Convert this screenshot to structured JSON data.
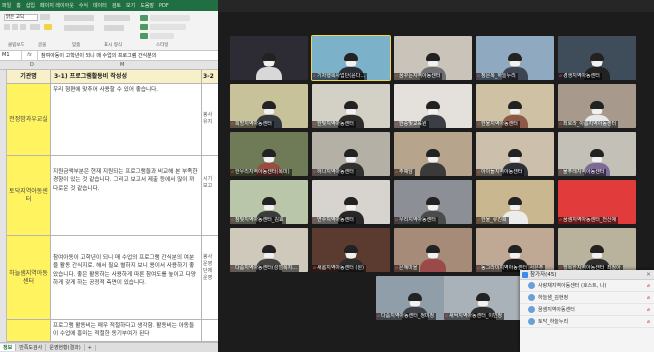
{
  "excel": {
    "ribbon_tabs": [
      "파일",
      "홈",
      "삽입",
      "페이지 레이아웃",
      "수식",
      "데이터",
      "검토",
      "보기",
      "도움말",
      "PDF"
    ],
    "font_box": "맑은 고딕",
    "ribbon_labels": [
      "클립보드",
      "글꼴",
      "맞춤",
      "표시 형식",
      "스타일"
    ],
    "formula_bar": {
      "cell_ref": "M1",
      "fx": "fx",
      "text": "참여아동이 고학년이 되니 매 수업의 프로그램 간식분의"
    },
    "columns": [
      "D",
      "M"
    ],
    "header_row": {
      "category": "기관명",
      "text": "3-1) 프로그램활동비 작성성",
      "side": "3-2"
    },
    "rows": [
      {
        "category": "전정밤과우교실",
        "text": "우리 형편에 맞추어 사용할 수 있어 좋습니다.",
        "side": "봉사 유지"
      },
      {
        "category": "토닥지역아동센터",
        "text": "지원금액부분은 현재 지원되는 프로그램들과 비교해 본 부족한 경향이 있는 것 같습니다. 그리고 보고서 제출 등에서 많이 까다로운 것 같습니다.",
        "side": "시기 보고"
      },
      {
        "category": "하늘샘지역아동센터",
        "text": "참여아동이 고학년이 되니 매 수업의 프로그램 간식분의 여분을 활동 간식지로. 해서 필요 별하지 보니 용이서 사용하기 좋았습니다. 좋은 활동하는 사용하게 따른 참여도를 높이고 다양하게 갖게 하는 공정적 측면이 있습니다.",
        "side": "봉사 운영 단체 운영"
      },
      {
        "category": "",
        "text": "프로그램 활동비는 매우 적절하다고 생각함. 활동비는 아동들이 수업에 흥미는 적절한 동기부여가 된다",
        "side": ""
      }
    ],
    "sheet_tabs": [
      "정보",
      "만족도검사",
      "운영현황(결과)",
      "+"
    ]
  },
  "zoom": {
    "participants": [
      {
        "name": "",
        "bg": "#2d2b33",
        "shirt": "#d8d8d8"
      },
      {
        "name": "기차행복사업단(윤다...",
        "bg": "#7bb2c9",
        "shirt": "#2a2d36",
        "active": true
      },
      {
        "name": "꿈꾸는지역아동센터",
        "bg": "#c9c3b9",
        "shirt": "#6d6f73"
      },
      {
        "name": "정은복_하늘누리",
        "bg": "#8fa9c0",
        "shirt": "#3e4552"
      },
      {
        "name": "경생지역아동센터",
        "bg": "#3f4c5a",
        "shirt": "#222"
      },
      {
        "name": "희망지역아동센터",
        "bg": "#c8c29a",
        "shirt": "#33373f"
      },
      {
        "name": "한빛지역아동센터",
        "bg": "#d3d0c5",
        "shirt": "#2c2c2c"
      },
      {
        "name": "한중빛교육원",
        "bg": "#e4e1dc",
        "shirt": "#3c3e45"
      },
      {
        "name": "한울지역아동센터",
        "bg": "#cfc2a4",
        "shirt": "#8d5a4a"
      },
      {
        "name": "최로라_아름지역아동센터",
        "bg": "#a79a8c",
        "shirt": "#e9e9e9"
      },
      {
        "name": "한우리지역아동센터(복미)",
        "bg": "#6f7b56",
        "shirt": "#9b4b40"
      },
      {
        "name": "하나지역아동센터",
        "bg": "#b4b0a6",
        "shirt": "#303030"
      },
      {
        "name": "주예담",
        "bg": "#b6a48c",
        "shirt": "#3a3a3a"
      },
      {
        "name": "아이들지역아동센터",
        "bg": "#ccbfab",
        "shirt": "#2e3038"
      },
      {
        "name": "물푸레지역아동센터",
        "bg": "#c3c0b8",
        "shirt": "#7e6a9a"
      },
      {
        "name": "참빛지역아동센터_김효",
        "bg": "#b9c6a9",
        "shirt": "#3b3b3b"
      },
      {
        "name": "연수지역아동센터",
        "bg": "#d7d4cf",
        "shirt": "#272727"
      },
      {
        "name": "우리지역아동센터",
        "bg": "#8c8f95",
        "shirt": "#4b4b4b"
      },
      {
        "name": "한울_류진희",
        "bg": "#c9b78f",
        "shirt": "#ececec"
      },
      {
        "name": "꿈샘지역아동센터_전신애",
        "bg": "#e13b3b",
        "shirt": "#d43030",
        "nobody": true
      },
      {
        "name": "다솜지역아동센터(성철복지...",
        "bg": "#cfc9bc",
        "shirt": "#414141"
      },
      {
        "name": "새롬지역아동센터 (원)",
        "bg": "#5b3a2f",
        "shirt": "#2b2b2b"
      },
      {
        "name": "은혜마을",
        "bg": "#a58b78",
        "shirt": "#9b4a4a"
      },
      {
        "name": "동그라미지역아동센터_서은주",
        "bg": "#bfa894",
        "shirt": "#1f1f1f"
      },
      {
        "name": "행복한지역아동센터_최정아",
        "bg": "#b9b29c",
        "shirt": "#2d2d2d"
      },
      {
        "name": "다솜지역아동센터_정미정",
        "bg": "#8f9ea8",
        "shirt": "#3d4048"
      },
      {
        "name": "새싹지역아동센터_이민정",
        "bg": "#a8b2b8",
        "shirt": "#2f2f2f"
      }
    ],
    "panel": {
      "title": "참가자(45)",
      "close": "×",
      "rows": [
        "사랑채지역아동센터 (호스트, 나)",
        "하늘샘_김현정",
        "꿈샘지역아동센터",
        "토닥_하늘누리"
      ]
    }
  }
}
